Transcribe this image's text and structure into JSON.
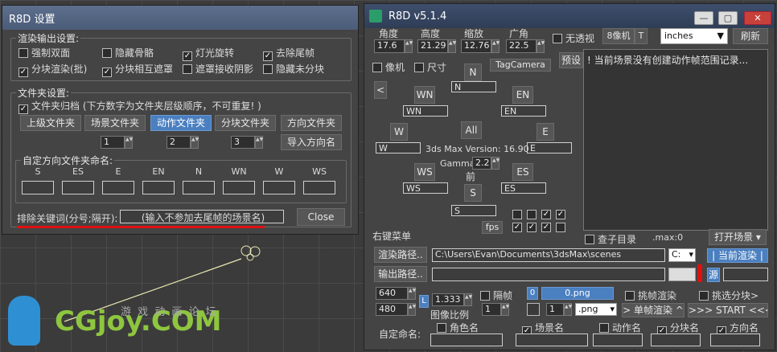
{
  "left_window": {
    "title": "R8D 设置",
    "render_group": {
      "title": "渲染输出设置:",
      "options": [
        {
          "label": "强制双面",
          "checked": false
        },
        {
          "label": "隐藏骨骼",
          "checked": false
        },
        {
          "label": "灯光旋转",
          "checked": true
        },
        {
          "label": "去除尾帧",
          "checked": true
        },
        {
          "label": "分块渲染(批)",
          "checked": true
        },
        {
          "label": "分块相互遮罩",
          "checked": true
        },
        {
          "label": "遮罩接收阴影",
          "checked": false
        },
        {
          "label": "隐藏未分块",
          "checked": false
        }
      ]
    },
    "folder_group": {
      "title": "文件夹设置:",
      "archive_label": "文件夹归档 (下方数字为文件夹层级顺序，不可重复! )",
      "archive_checked": true,
      "buttons": [
        "上级文件夹",
        "场景文件夹",
        "动作文件夹",
        "分块文件夹",
        "方向文件夹"
      ],
      "levels": [
        "1",
        "2",
        "3"
      ],
      "import_button": "导入方向名"
    },
    "dir_group": {
      "title": "自定方向文件夹命名:",
      "dirs": [
        "S",
        "ES",
        "E",
        "EN",
        "N",
        "WN",
        "W",
        "WS"
      ]
    },
    "exclude_label": "排除关键词(分号;隔开):",
    "exclude_placeholder": "(输入不参加去尾帧的场景名)",
    "close": "Close"
  },
  "right_window": {
    "title": "R8D v5.1.4",
    "cam_labels": [
      "角度",
      "高度",
      "缩放",
      "广角"
    ],
    "cam_values": [
      "17.6",
      "21.29",
      "12.76",
      "22.5"
    ],
    "opaque": "无透视",
    "eight": "8像机",
    "t_btn": "T",
    "units": "inches",
    "refresh": "刷新",
    "pixel": "像机",
    "size": "尺寸",
    "preset": "预设",
    "tagcamera": "TagCamera",
    "log": "! 当前场景没有创建动作帧范围记录...",
    "dirs": {
      "n": "N",
      "wn": "WN",
      "en": "EN",
      "w": "W",
      "all": "All",
      "e": "E",
      "ws": "WS",
      "es": "ES",
      "s": "S",
      "left": "<"
    },
    "version": "3ds Max Version: 16.90",
    "gamma_label": "Gamma:",
    "gamma": "2.2",
    "front": "前",
    "fps": "fps",
    "view_dir": "查子目录",
    "maxinfo": ".max:0",
    "open_scene": "打开场景 ▾",
    "rclick": "右键菜单",
    "render_path_btn": "渲染路径..",
    "render_path": "C:\\Users\\Evan\\Documents\\3dsMax\\scenes",
    "drive": "C:",
    "current_render": "| 当前渲染 |",
    "output_path_btn": "输出路径..",
    "source": "源",
    "width": "640",
    "height": "480",
    "aspect": "1.333",
    "aspect_label": "图像比例",
    "l_btn": "L",
    "skip_label": "隔帧",
    "skip": "1",
    "frame_start": "0",
    "frame_name": "0.png",
    "frame_step": "1",
    "format": ".png",
    "pick_render": "挑帧渲染",
    "batch_pick": "挑选分块>",
    "single_render": "> 单帧渲染 ^",
    "start": ">>> START <<<",
    "custom_name": "自定命名:",
    "name_opts": [
      {
        "label": "角色名",
        "checked": false
      },
      {
        "label": "场景名",
        "checked": true
      },
      {
        "label": "动作名",
        "checked": false
      },
      {
        "label": "分块名",
        "checked": true
      },
      {
        "label": "方向名",
        "checked": true
      }
    ],
    "controls": [
      "—",
      "▢",
      "✕"
    ]
  },
  "watermark": {
    "logo": "CGjoy.COM",
    "caption": "游 戏 动 画 论 坛"
  },
  "colors": {
    "accent": "#4a7fc0",
    "red": "#e01010"
  }
}
